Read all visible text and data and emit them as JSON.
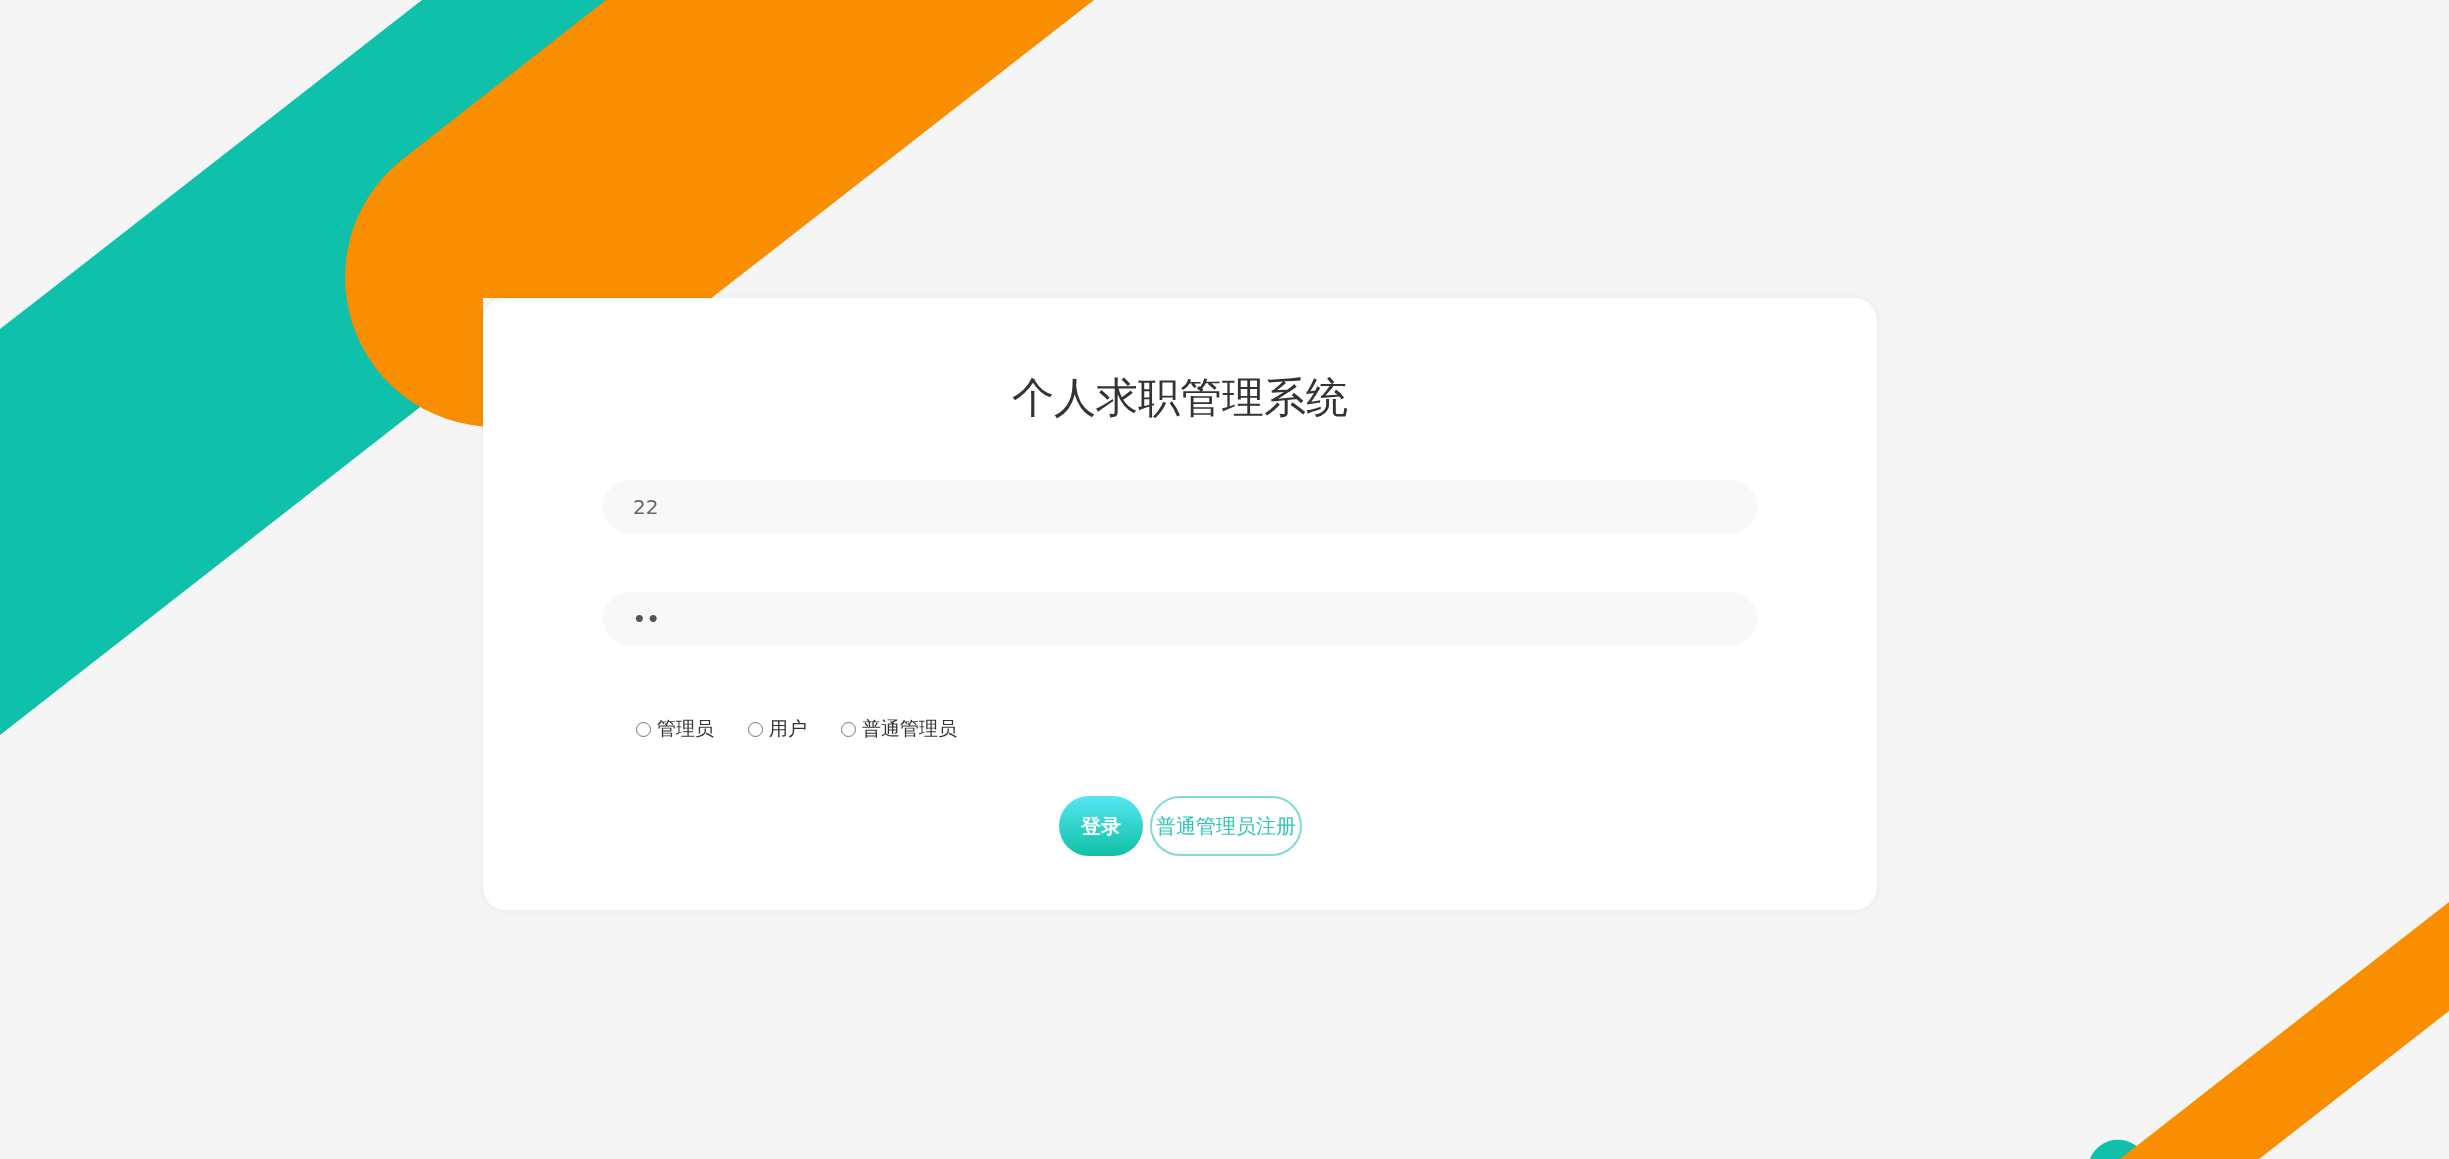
{
  "title": "个人求职管理系统",
  "fields": [
    {
      "kind": "text",
      "value": "22"
    },
    {
      "kind": "password",
      "value": "••"
    }
  ],
  "roles": [
    {
      "label": "管理员",
      "selected": false
    },
    {
      "label": "用户",
      "selected": false
    },
    {
      "label": "普通管理员",
      "selected": false
    }
  ],
  "buttons": [
    {
      "kind": "primary",
      "label": "登录"
    },
    {
      "kind": "outline",
      "label": "普通管理员注册"
    }
  ]
}
